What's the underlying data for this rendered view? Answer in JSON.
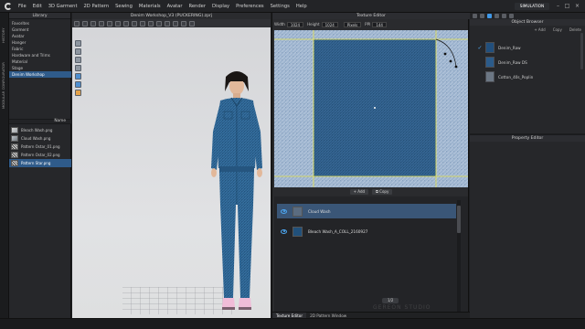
{
  "menubar": {
    "items": [
      "File",
      "Edit",
      "3D Garment",
      "2D Pattern",
      "Sewing",
      "Materials",
      "Avatar",
      "Render",
      "Display",
      "Preferences",
      "Settings",
      "Help"
    ],
    "simulation_label": "SIMULATION"
  },
  "left_strip": {
    "tabs": [
      "HISTORY",
      "MODULAR CONFIGURATOR"
    ]
  },
  "library": {
    "title": "Library",
    "tree": [
      {
        "label": "Favorites",
        "selected": false
      },
      {
        "label": "Garment",
        "selected": false
      },
      {
        "label": "Avatar",
        "selected": false
      },
      {
        "label": "Hanger",
        "selected": false
      },
      {
        "label": "Fabric",
        "selected": false
      },
      {
        "label": "Hardware and Trims",
        "selected": false
      },
      {
        "label": "Material",
        "selected": false
      },
      {
        "label": "Stage",
        "selected": false
      },
      {
        "label": "Denim Workshop",
        "selected": true
      }
    ],
    "files_header": "Name",
    "files": [
      {
        "label": "Bleach Wash.png",
        "thumb": "bleach",
        "selected": false
      },
      {
        "label": "Cloud Wash.png",
        "thumb": "cloud",
        "selected": false
      },
      {
        "label": "Pattern Ostar_01.png",
        "thumb": "pat",
        "selected": false
      },
      {
        "label": "Pattern Ostar_02.png",
        "thumb": "pat",
        "selected": false
      },
      {
        "label": "Pattern Star.png",
        "thumb": "pat",
        "selected": true
      }
    ]
  },
  "viewport": {
    "title": "Denim Workshop_V3 (PUCKERING).zprj",
    "version": "Version: 6.0.376 (r10286)"
  },
  "texture_editor": {
    "title": "Texture Editor",
    "width_label": "Width",
    "width_value": "1024",
    "height_label": "Height",
    "height_value": "1024",
    "unit_value": "Pixels",
    "ppi_label": "PPI",
    "ppi_value": "144",
    "add_label": "Add",
    "copy_label": "Copy",
    "layers": [
      {
        "label": "Cloud Wash",
        "selected": true,
        "swatch": "#5b6c80"
      },
      {
        "label": "Bleach Wash_A_COLL_2160927",
        "selected": false,
        "swatch": "#21507a"
      }
    ],
    "page_label": "1/2",
    "tabs": [
      "Texture Editor",
      "2D Pattern Window"
    ]
  },
  "object_browser": {
    "title": "Object Browser",
    "actions": [
      "+ Add",
      "Copy",
      "Delete"
    ],
    "fabrics": [
      {
        "label": "Denim_Raw",
        "checked": true,
        "swatch": "#214f7d"
      },
      {
        "label": "Denim_Raw DS",
        "checked": false,
        "swatch": "#2b5b8a"
      },
      {
        "label": "Cotton_40s_Poplin",
        "checked": false,
        "swatch": "#6c7784"
      }
    ],
    "property_title": "Property Editor"
  },
  "colors": {
    "accent": "#3f98e8",
    "denim": "#2a5f8c",
    "selection": "#2f5b8a"
  },
  "watermark": "GEREON STUDIO"
}
